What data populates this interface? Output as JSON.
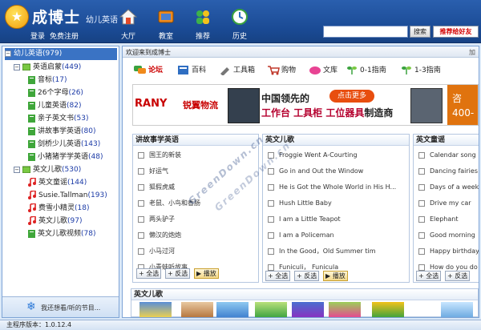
{
  "header": {
    "title": "成博士",
    "subtitle": "幼儿英语",
    "login": "登录",
    "register": "免费注册",
    "nav": [
      {
        "label": "大厅",
        "icon": "home-icon"
      },
      {
        "label": "教室",
        "icon": "tv-icon"
      },
      {
        "label": "推荐",
        "icon": "people-icon"
      },
      {
        "label": "历史",
        "icon": "refresh-icon"
      }
    ],
    "search_value": "",
    "search_button": "搜索",
    "recommend_button": "推荐给好友"
  },
  "sidebar": {
    "root": {
      "label": "幼儿英语",
      "count": "(979)"
    },
    "groups": [
      {
        "label": "英语启蒙",
        "count": "(449)",
        "items": [
          {
            "label": "音标",
            "count": "(17)"
          },
          {
            "label": "26个字母",
            "count": "(26)"
          },
          {
            "label": "儿童英语",
            "count": "(82)"
          },
          {
            "label": "亲子英文书",
            "count": "(53)"
          },
          {
            "label": "讲故事学英语",
            "count": "(80)"
          },
          {
            "label": "剑桥少儿英语",
            "count": "(143)"
          },
          {
            "label": "小猪猪学学英语",
            "count": "(48)"
          }
        ]
      },
      {
        "label": "英文儿歌",
        "count": "(530)",
        "items": [
          {
            "label": "英文童谣",
            "count": "(144)"
          },
          {
            "label": "Susie.Tallman",
            "count": "(193)"
          },
          {
            "label": "费雪小精灵",
            "count": "(18)"
          },
          {
            "label": "英文儿歌",
            "count": "(97)"
          },
          {
            "label": "英文儿歌视频",
            "count": "(78)"
          }
        ]
      }
    ],
    "footer_text": "我还想看/听的节目..."
  },
  "main": {
    "title": "欢迎来到成博士",
    "add_label": "加",
    "quick_links": [
      {
        "label": "论坛",
        "icon": "forum-icon"
      },
      {
        "label": "百科",
        "icon": "encyclopedia-icon"
      },
      {
        "label": "工具箱",
        "icon": "toolbox-icon"
      },
      {
        "label": "购物",
        "icon": "cart-icon"
      },
      {
        "label": "文库",
        "icon": "library-icon"
      },
      {
        "label": "0-1指南",
        "icon": "sprout-icon"
      },
      {
        "label": "1-3指南",
        "icon": "sprout-icon"
      }
    ],
    "banner": {
      "brand": "RANY",
      "brand_cn": "锐翼物流",
      "line1": "中国领先的",
      "line2": "工作台 工具柜 工位器具",
      "line2_suffix": "制造商",
      "button": "点击更多",
      "right_text1": "咨",
      "right_text2": "400-"
    },
    "columns": [
      {
        "title": "讲故事学英语",
        "items": [
          "国王的新装",
          "好运气",
          "狐假虎威",
          "老鼠、小鸟和香肠",
          "两头驴子",
          "懒汉的炮炮",
          "小马过河",
          "小青蛙听故事"
        ]
      },
      {
        "title": "英文儿歌",
        "items": [
          "Froggie Went A-Courting",
          "Go in and Out the Window",
          "He is Got the Whole World in His H...",
          "Hush Little Baby",
          "I am a Little Teapot",
          "I am a Policeman",
          "In the Good，Old Summer tim",
          "Funiculi， Funicula"
        ]
      },
      {
        "title": "英文童谣",
        "items": [
          "Calendar song",
          "Dancing fairies",
          "Days of a week",
          "Drive my car",
          "Elephant",
          "Good morning",
          "Happy birthday",
          "How do you do"
        ]
      }
    ],
    "column_buttons": {
      "select_all": "全选",
      "invert": "反选",
      "play": "播放"
    },
    "lower_title": "英文儿歌"
  },
  "watermark": "GreenDown.cn",
  "status": "主程序版本：1.0.12.4"
}
